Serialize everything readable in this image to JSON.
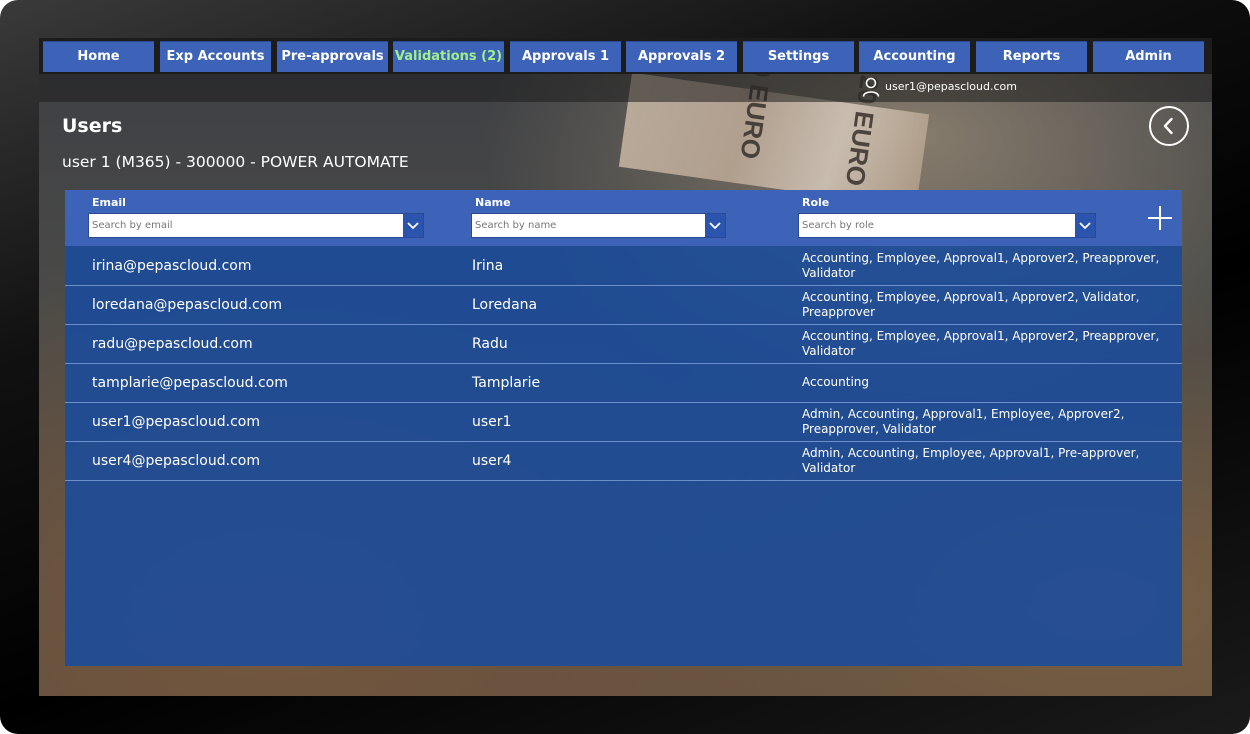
{
  "nav": {
    "items": [
      {
        "label": "Home"
      },
      {
        "label": "Exp Accounts"
      },
      {
        "label": "Pre-approvals"
      },
      {
        "label": "Validations (2)"
      },
      {
        "label": "Approvals 1"
      },
      {
        "label": "Approvals 2"
      },
      {
        "label": "Settings"
      },
      {
        "label": "Accounting"
      },
      {
        "label": "Reports"
      },
      {
        "label": "Admin"
      }
    ],
    "active_item": "Validations (2)",
    "active_color": "#9ff08a"
  },
  "user": {
    "email": "user1@pepascloud.com",
    "icon": "user-icon"
  },
  "page": {
    "title": "Users",
    "subtitle": "user 1 (M365) - 300000 - POWER AUTOMATE",
    "back_icon": "chevron-left-circle-icon"
  },
  "filters": {
    "email": {
      "label": "Email",
      "placeholder": "Search by email"
    },
    "name": {
      "label": "Name",
      "placeholder": "Search by name"
    },
    "role": {
      "label": "Role",
      "placeholder": "Search by role"
    },
    "add_icon": "plus-icon"
  },
  "colors": {
    "nav_button": "#3d63b8",
    "panel": "#184c9e",
    "header": "#3d63b8"
  },
  "users": [
    {
      "email": "irina@pepascloud.com",
      "name": "Irina",
      "role": "Accounting, Employee, Approval1, Approver2, Preapprover, Validator"
    },
    {
      "email": "loredana@pepascloud.com",
      "name": "Loredana",
      "role": "Accounting, Employee, Approval1, Approver2, Validator, Preapprover"
    },
    {
      "email": "radu@pepascloud.com",
      "name": "Radu",
      "role": "Accounting, Employee, Approval1, Approver2, Preapprover, Validator"
    },
    {
      "email": "tamplarie@pepascloud.com",
      "name": "Tamplarie",
      "role": "Accounting"
    },
    {
      "email": "user1@pepascloud.com",
      "name": "user1",
      "role": "Admin, Accounting, Approval1, Employee, Approver2, Preapprover, Validator"
    },
    {
      "email": "user4@pepascloud.com",
      "name": "user4",
      "role": "Admin, Accounting, Employee, Approval1, Pre-approver, Validator"
    }
  ],
  "background": {
    "banknote_labels": [
      "20 EURO",
      "20 EURO"
    ]
  }
}
